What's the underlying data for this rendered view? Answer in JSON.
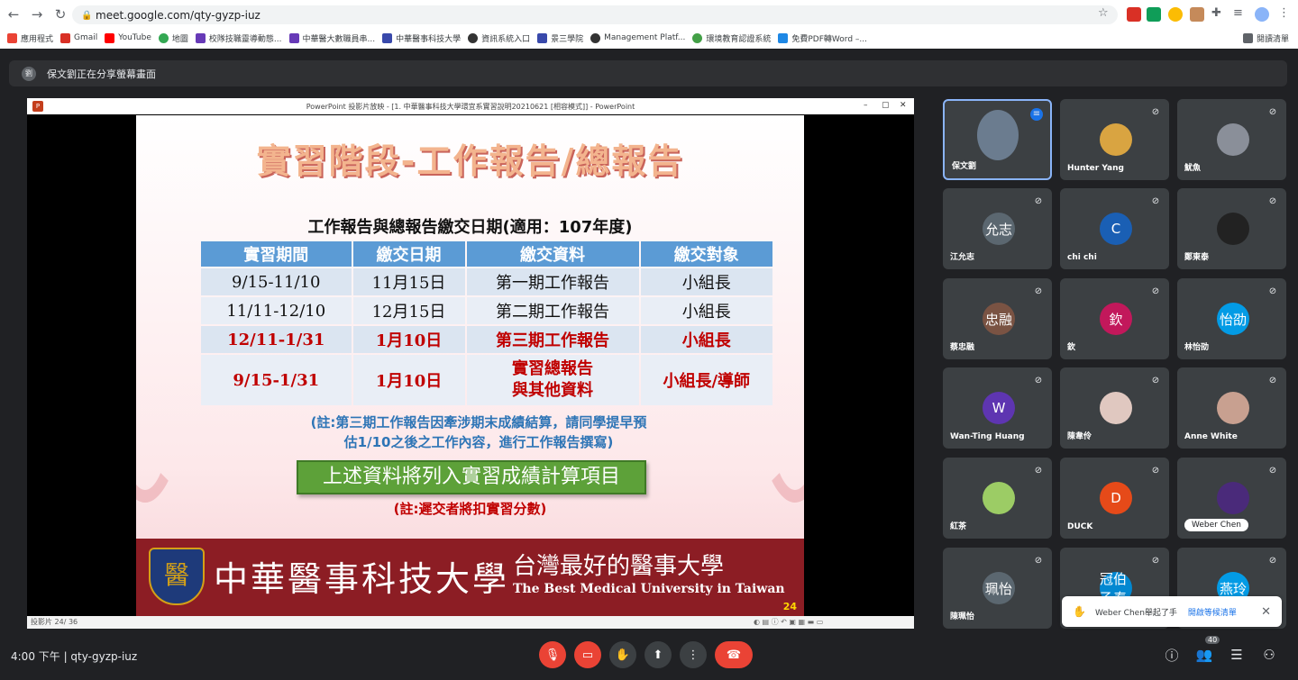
{
  "browser": {
    "url": "meet.google.com/qty-gyzp-iuz",
    "bookmarks": [
      "應用程式",
      "Gmail",
      "YouTube",
      "地圖",
      "校隊技職靈導動態...",
      "中華醫大數職員串...",
      "中華醫事科技大學",
      "資訊系統入口",
      "景三學院",
      "Management Platf...",
      "環境教育認證系統",
      "免費PDF轉Word –..."
    ],
    "reading_list": "閱讀清單"
  },
  "meet": {
    "presenting_banner": "保文劉正在分享螢幕畫面",
    "banner_avatar": "劉",
    "time_code": "4:00 下午 | qty-gyzp-iuz",
    "people_count": "40",
    "toast_text": "Weber Chen舉起了手",
    "toast_link": "開啟等候清單"
  },
  "powerpoint": {
    "window_title": "PowerPoint 投影片放映 - [1. 中華醫事科技大學環宜系實習說明20210621 [相容模式]] - PowerPoint",
    "status": "投影片 24/ 36"
  },
  "slide": {
    "title": "實習階段-工作報告/總報告",
    "subtitle": "工作報告與總報告繳交日期(適用：107年度)",
    "headers": [
      "實習期間",
      "繳交日期",
      "繳交資料",
      "繳交對象"
    ],
    "rows": [
      [
        "9/15-11/10",
        "11月15日",
        "第一期工作報告",
        "小組長"
      ],
      [
        "11/11-12/10",
        "12月15日",
        "第二期工作報告",
        "小組長"
      ],
      [
        "12/11-1/31",
        "1月10日",
        "第三期工作報告",
        "小組長"
      ],
      [
        "9/15-1/31",
        "1月10日",
        "實習總報告\n與其他資料",
        "小組長/導師"
      ]
    ],
    "note_line1": "(註:第三期工作報告因牽涉期末成績結算，請同學提早預",
    "note_line2": "估1/10之後之工作內容，進行工作報告撰寫)",
    "green_box": "上述資料將列入實習成績計算項目",
    "note2": "(註:遲交者將扣實習分數)",
    "school_zh": "中華醫事科技大學",
    "slogan_zh": "台灣最好的醫事大學",
    "slogan_en": "The Best Medical University in Taiwan",
    "page_num": "24",
    "crest_char": "醫"
  },
  "participants": [
    {
      "name": "保文劉",
      "avatar": "",
      "color": "#6b7c8f",
      "active": true
    },
    {
      "name": "Hunter Yang",
      "avatar": "",
      "color": "#d9a441"
    },
    {
      "name": "魷魚",
      "avatar": "",
      "color": "#8a8f99"
    },
    {
      "name": "江允志",
      "avatar": "允志",
      "color": "#5b6770"
    },
    {
      "name": "chi chi",
      "avatar": "C",
      "color": "#1a5fb4"
    },
    {
      "name": "鄭東泰",
      "avatar": "",
      "color": "#222"
    },
    {
      "name": "蔡忠融",
      "avatar": "忠融",
      "color": "#7a5343"
    },
    {
      "name": "欽",
      "avatar": "欽",
      "color": "#c2185b"
    },
    {
      "name": "林怡劭",
      "avatar": "怡劭",
      "color": "#039be5"
    },
    {
      "name": "Wan-Ting Huang",
      "avatar": "W",
      "color": "#5e35b1"
    },
    {
      "name": "陳韋伶",
      "avatar": "",
      "color": "#e0c8c0"
    },
    {
      "name": "Anne White",
      "avatar": "",
      "color": "#c8a090"
    },
    {
      "name": "紅茶",
      "avatar": "",
      "color": "#9ccc65"
    },
    {
      "name": "DUCK",
      "avatar": "D",
      "color": "#e64a19"
    },
    {
      "name": "Weber Chen",
      "avatar": "",
      "color": "#4a2a7a"
    },
    {
      "name": "陳珮怡",
      "avatar": "珮怡",
      "color": "#5b6770"
    },
    {
      "name": "",
      "avatar": "冠伯 乙泰",
      "color": "#0288d1"
    },
    {
      "name": "",
      "avatar": "燕玲",
      "color": "#039be5"
    }
  ]
}
